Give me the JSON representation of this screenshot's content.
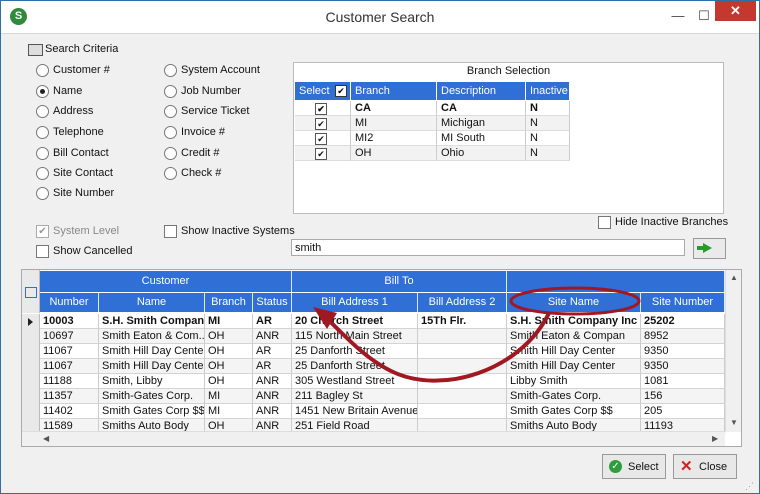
{
  "window": {
    "title": "Customer Search",
    "app_icon": "S",
    "minimize": "—",
    "maximize": "☐",
    "close": "✕"
  },
  "criteria": {
    "label": "Search Criteria",
    "left_options": [
      "Customer #",
      "Name",
      "Address",
      "Telephone",
      "Bill Contact",
      "Site Contact",
      "Site Number"
    ],
    "right_options": [
      "System Account",
      "Job Number",
      "Service Ticket",
      "Invoice #",
      "Credit #",
      "Check #"
    ],
    "selected": "Name",
    "system_level": "System Level",
    "show_cancelled": "Show Cancelled",
    "show_inactive_systems": "Show Inactive Systems"
  },
  "branch_selection": {
    "title": "Branch Selection",
    "headers": [
      "Select",
      "Branch",
      "Description",
      "Inactive"
    ],
    "rows": [
      {
        "branch": "CA",
        "description": "CA",
        "inactive": "N",
        "checked": true
      },
      {
        "branch": "MI",
        "description": "Michigan",
        "inactive": "N",
        "checked": true
      },
      {
        "branch": "MI2",
        "description": "MI South",
        "inactive": "N",
        "checked": true
      },
      {
        "branch": "OH",
        "description": "Ohio",
        "inactive": "N",
        "checked": true
      }
    ],
    "hide_inactive": "Hide Inactive Branches"
  },
  "search": {
    "value": "smith"
  },
  "grid": {
    "bands": [
      "Customer",
      "Bill To",
      ""
    ],
    "headers": [
      "Number",
      "Name",
      "Branch",
      "Status",
      "Bill Address 1",
      "Bill Address 2",
      "Site Name",
      "Site Number"
    ],
    "rows": [
      [
        "10003",
        "S.H. Smith Compan...",
        "MI",
        "AR",
        "20 Church Street",
        "15Th Flr.",
        "S.H. Smith Company Inc",
        "25202"
      ],
      [
        "10697",
        "Smith  Eaton & Com...",
        "OH",
        "ANR",
        "115 North Main Street",
        "",
        "Smith  Eaton & Compan",
        "8952"
      ],
      [
        "11067",
        "Smith Hill Day Center",
        "OH",
        "AR",
        "25 Danforth Street",
        "",
        "Smith Hill Day Center",
        "9350"
      ],
      [
        "11067",
        "Smith Hill Day Center",
        "OH",
        "AR",
        "25 Danforth Street",
        "",
        "Smith Hill Day Center",
        "9350"
      ],
      [
        "11188",
        "Smith, Libby",
        "OH",
        "ANR",
        "305 Westland Street",
        "",
        "Libby Smith",
        "1081"
      ],
      [
        "11357",
        "Smith-Gates Corp.",
        "MI",
        "ANR",
        "211 Bagley St",
        "",
        "Smith-Gates Corp.",
        "156"
      ],
      [
        "11402",
        "Smith Gates Corp $$",
        "MI",
        "ANR",
        "1451 New Britain Avenue",
        "",
        "Smith Gates Corp $$",
        "205"
      ],
      [
        "11589",
        "Smiths Auto Body",
        "OH",
        "ANR",
        "251 Field Road",
        "",
        "Smiths Auto Body",
        "11193"
      ]
    ]
  },
  "buttons": {
    "select": "Select",
    "close": "Close"
  },
  "annotation": {
    "color": "#a01822"
  }
}
